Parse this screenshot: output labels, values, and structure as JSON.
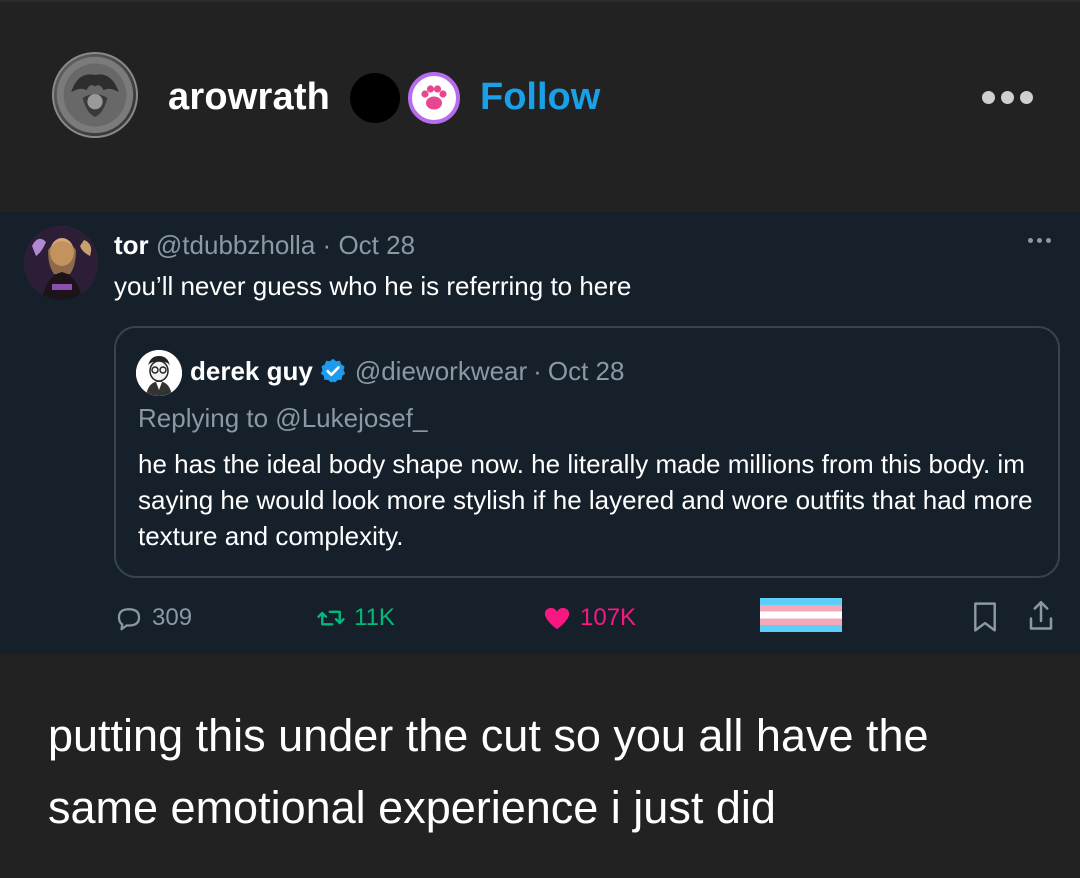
{
  "post": {
    "blog_name": "arowrath",
    "follow_label": "Follow",
    "caption": "putting this under the cut so you all have the same emotional experience i just did"
  },
  "tweet": {
    "display_name": "tor",
    "handle": "@tdubbzholla",
    "separator": "·",
    "date": "Oct 28",
    "text": "you’ll never guess who he is referring to here",
    "quote": {
      "display_name": "derek guy",
      "handle": "@dieworkwear",
      "separator": "·",
      "date": "Oct 28",
      "replying_to": "Replying to @Lukejosef_",
      "text": "he has the ideal body shape now. he literally made millions from this body. im saying he would look more stylish if he layered and wore outfits that had more texture and complexity."
    },
    "stats": {
      "replies": "309",
      "retweets": "11K",
      "likes": "107K"
    }
  },
  "colors": {
    "page_bg": "#222222",
    "tweet_bg": "#15202b",
    "follow": "#1aa0e8",
    "retweet": "#00ba7c",
    "like": "#f91880",
    "muted": "#8b98a5"
  }
}
